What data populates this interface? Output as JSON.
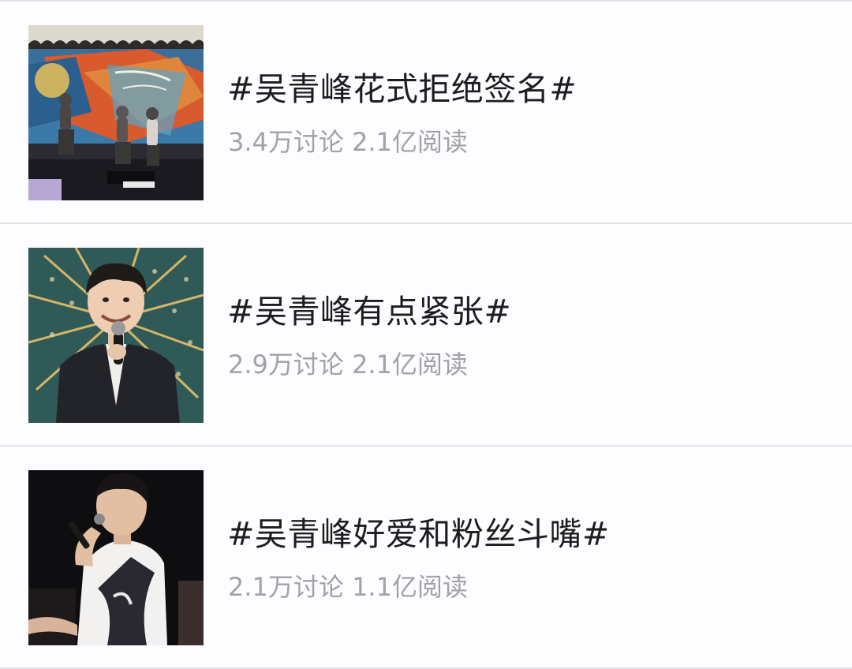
{
  "topics": [
    {
      "title": "#吴青峰花式拒绝签名#",
      "stats": "3.4万讨论 2.1亿阅读",
      "thumbnail_icon": "concert-stage-photo"
    },
    {
      "title": "#吴青峰有点紧张#",
      "stats": "2.9万讨论 2.1亿阅读",
      "thumbnail_icon": "singer-portrait-photo"
    },
    {
      "title": "#吴青峰好爱和粉丝斗嘴#",
      "stats": "2.1万讨论 1.1亿阅读",
      "thumbnail_icon": "singer-performing-photo"
    }
  ],
  "colors": {
    "background": "#fdfcfe",
    "divider": "#e3e2e6",
    "title": "#1d1d1f",
    "stats": "#a2a2a6"
  }
}
